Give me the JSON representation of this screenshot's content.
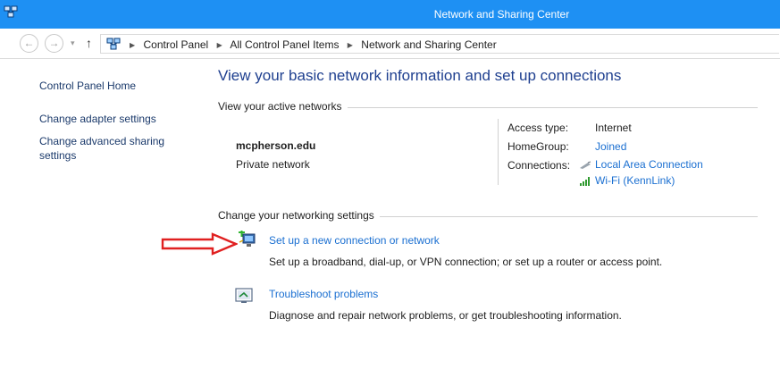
{
  "window": {
    "title": "Network and Sharing Center"
  },
  "address": {
    "crumbs": [
      "Control Panel",
      "All Control Panel Items",
      "Network and Sharing Center"
    ]
  },
  "nav": {
    "back": "←",
    "forward": "→",
    "recent": "▾",
    "up": "↑"
  },
  "sidebar": {
    "items": [
      {
        "label": "Control Panel Home"
      },
      {
        "label": "Change adapter settings"
      },
      {
        "label": "Change advanced sharing settings"
      }
    ]
  },
  "main": {
    "title": "View your basic network information and set up connections",
    "active_networks_heading": "View your active networks",
    "network": {
      "name": "mcpherson.edu",
      "type": "Private network",
      "access_type_label": "Access type:",
      "access_type_value": "Internet",
      "homegroup_label": "HomeGroup:",
      "homegroup_value": "Joined",
      "connections_label": "Connections:",
      "connections": [
        "Local Area Connection",
        "Wi-Fi (KennLink)"
      ]
    },
    "settings_heading": "Change your networking settings",
    "tasks": [
      {
        "label": "Set up a new connection or network",
        "description": "Set up a broadband, dial-up, or VPN connection; or set up a router or access point."
      },
      {
        "label": "Troubleshoot problems",
        "description": "Diagnose and repair network problems, or get troubleshooting information."
      }
    ]
  },
  "colors": {
    "titlebar": "#1e90f3",
    "link": "#1a6fd1",
    "heading": "#1e3f8f",
    "annotation_arrow": "#e02020"
  },
  "icons": {
    "app": "network-sharing-icon",
    "ethernet": "ethernet-connection-icon",
    "wifi": "wifi-signal-icon",
    "new_connection": "new-connection-icon",
    "troubleshoot": "troubleshoot-icon",
    "arrow": "red-annotation-arrow"
  }
}
